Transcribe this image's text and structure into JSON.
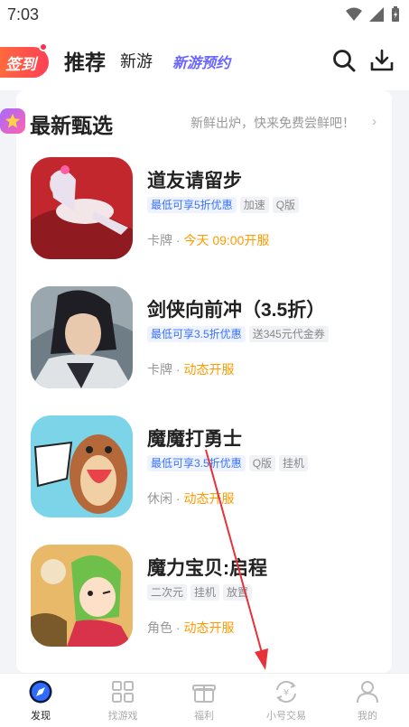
{
  "status": {
    "time": "7:03"
  },
  "top_nav": {
    "checkin": "签到",
    "tabs": [
      "推荐",
      "新游",
      "新游预约"
    ]
  },
  "section": {
    "title": "最新甄选",
    "subtitle": "新鲜出炉，快来免费尝鲜吧！",
    "more": "›"
  },
  "games": [
    {
      "name": "道友请留步",
      "tags": [
        "最低可享5折优惠",
        "加速",
        "Q版"
      ],
      "category": "卡牌 · ",
      "release": "今天 09:00开服"
    },
    {
      "name": "剑侠向前冲（3.5折）",
      "tags": [
        "最低可享3.5折优惠",
        "送345元代金券"
      ],
      "category": "卡牌 · ",
      "release": "动态开服"
    },
    {
      "name": "魔魔打勇士",
      "tags": [
        "最低可享3.5折优惠",
        "Q版",
        "挂机"
      ],
      "category": "休闲 · ",
      "release": "动态开服"
    },
    {
      "name": "魔力宝贝:启程",
      "tags": [
        "二次元",
        "挂机",
        "放置"
      ],
      "category": "角色 · ",
      "release": "动态开服"
    }
  ],
  "bottom_nav": [
    "发现",
    "找游戏",
    "福利",
    "小号交易",
    "我的"
  ],
  "colors": {
    "accent": "#3a72ff",
    "orange": "#ff9a00",
    "checkin": "#ff4b4b",
    "reserve": "#6a66ff"
  }
}
